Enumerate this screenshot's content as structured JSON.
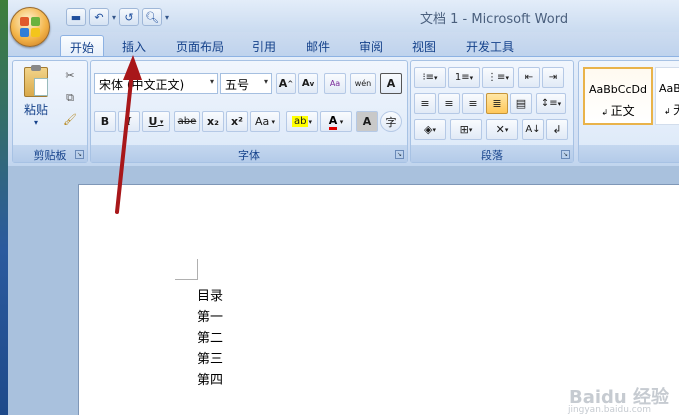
{
  "window": {
    "title": "文档 1 - Microsoft Word"
  },
  "qat": [
    "save-icon",
    "undo-icon",
    "redo-icon",
    "print-preview-icon"
  ],
  "tabs": [
    {
      "label": "开始",
      "active": true
    },
    {
      "label": "插入"
    },
    {
      "label": "页面布局"
    },
    {
      "label": "引用"
    },
    {
      "label": "邮件"
    },
    {
      "label": "审阅"
    },
    {
      "label": "视图"
    },
    {
      "label": "开发工具"
    }
  ],
  "clipboard": {
    "paste_label": "粘贴",
    "group_label": "剪贴板"
  },
  "font": {
    "font_name": "宋体 (中文正文)",
    "font_size": "五号",
    "grow": "A",
    "shrink": "A",
    "phonetic": "wén",
    "bold": "B",
    "italic": "I",
    "underline": "U",
    "strike": "abe",
    "subscript": "x₂",
    "superscript": "x²",
    "change_case": "Aa",
    "font_color": "A",
    "char_shading": "A",
    "enclose": "字",
    "group_label": "字体"
  },
  "paragraph": {
    "group_label": "段落"
  },
  "styles": [
    {
      "preview": "AaBbCcDd",
      "name": "正文"
    },
    {
      "preview": "AaB",
      "name": "无"
    }
  ],
  "document": {
    "lines": [
      "目录",
      "第一",
      "第二",
      "第三",
      "第四"
    ]
  },
  "watermark": {
    "text": "Baidu 经验",
    "sub": "jingyan.baidu.com"
  }
}
